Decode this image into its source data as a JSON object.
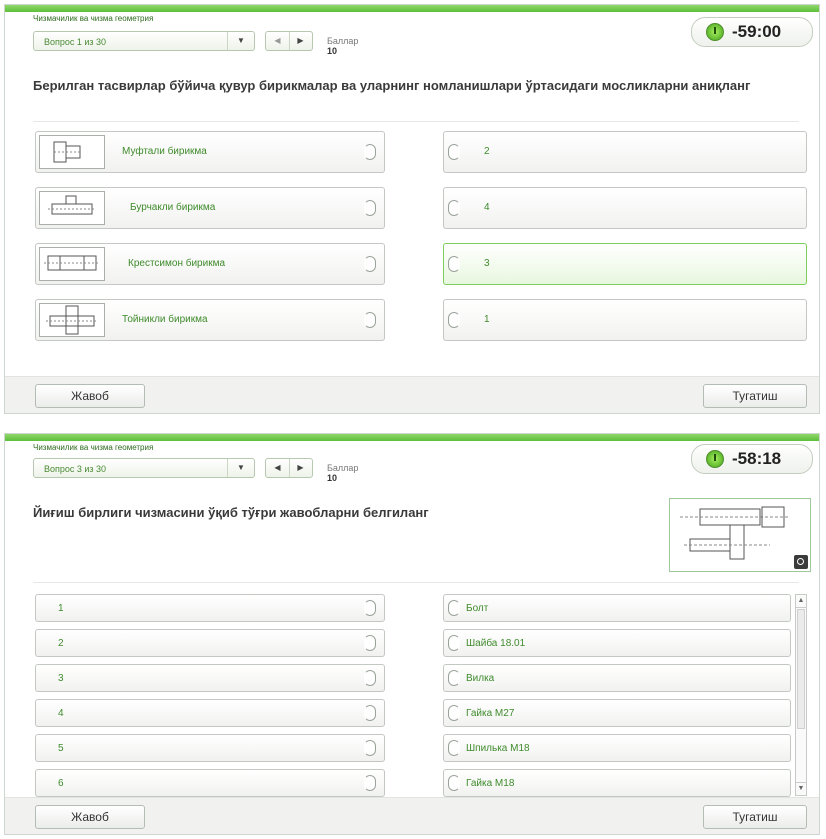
{
  "screen1": {
    "app_title": "Чизмачилик ва чизма геометрия",
    "question_select": "Вопрос 1 из 30",
    "score_label": "Баллар",
    "score_value": "10",
    "timer": "-59:00",
    "question": "Берилган тасвирлар бўйича қувур бирикмалар ва уларнинг номланишлари ўртасидаги мосликларни аниқланг",
    "left_items": [
      {
        "label": "Муфтали бирикма",
        "icon": "pipe-fitting-drawing-icon"
      },
      {
        "label": "Бурчакли бирикма",
        "icon": "pipe-fitting-drawing-icon"
      },
      {
        "label": "Крестсимон бирикма",
        "icon": "pipe-fitting-drawing-icon"
      },
      {
        "label": "Тойникли бирикма",
        "icon": "pipe-fitting-drawing-icon"
      }
    ],
    "right_items": [
      "2",
      "4",
      "3",
      "1"
    ],
    "answer_button": "Жавоб",
    "finish_button": "Тугатиш"
  },
  "screen2": {
    "app_title": "Чизмачилик ва чизма геометрия",
    "question_select": "Вопрос 3 из 30",
    "score_label": "Баллар",
    "score_value": "10",
    "timer": "-58:18",
    "question": "Йиғиш бирлиги чизмасини ўқиб тўғри жавобларни белгиланг",
    "left_items": [
      "1",
      "2",
      "3",
      "4",
      "5",
      "6"
    ],
    "right_items": [
      "Болт",
      "Шайба 18.01",
      "Вилка",
      "Гайка М27",
      "Шпилька М18",
      "Гайка М18"
    ],
    "answer_button": "Жавоб",
    "finish_button": "Тугатиш"
  },
  "icons": {
    "timer": "clock-icon",
    "dropdown": "chevron-down-icon",
    "prev": "triangle-left-icon",
    "next": "triangle-right-icon",
    "zoom": "magnifier-icon"
  },
  "colors": {
    "accent": "#5cbf3a",
    "label_green": "#3f8b2c",
    "selected_border": "#7ccd5c"
  }
}
